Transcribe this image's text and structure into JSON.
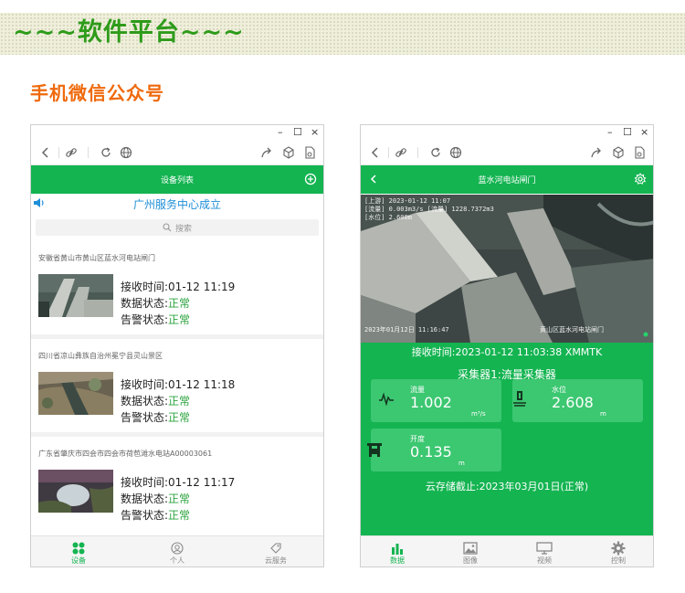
{
  "banner": {
    "title": "~~~软件平台~~~"
  },
  "section": {
    "title": "手机微信公众号"
  },
  "window": {
    "minimize": "–",
    "maximize": "☐",
    "close": "×"
  },
  "left_phone": {
    "header_title": "设备列表",
    "notice": "广州服务中心成立",
    "search_placeholder": "搜索",
    "devices": [
      {
        "title": "安徽省黄山市黄山区蓝水河电站闸门",
        "recv_label": "接收时间:",
        "recv_time": "01-12 11:19",
        "data_label": "数据状态:",
        "data_status": "正常",
        "alarm_label": "告警状态:",
        "alarm_status": "正常"
      },
      {
        "title": "四川省凉山彝族自治州冕宁县灵山景区",
        "recv_label": "接收时间:",
        "recv_time": "01-12 11:18",
        "data_label": "数据状态:",
        "data_status": "正常",
        "alarm_label": "告警状态:",
        "alarm_status": "正常"
      },
      {
        "title": "广东省肇庆市四会市四会市荷苞滩水电站A00003061",
        "recv_label": "接收时间:",
        "recv_time": "01-12 11:17",
        "data_label": "数据状态:",
        "data_status": "正常",
        "alarm_label": "告警状态:",
        "alarm_status": "正常"
      }
    ],
    "tabs": [
      {
        "label": "设备",
        "icon": "grid-icon"
      },
      {
        "label": "个人",
        "icon": "user-icon"
      },
      {
        "label": "云服务",
        "icon": "tag-icon"
      }
    ]
  },
  "right_phone": {
    "header_title": "蓝水河电站闸门",
    "video_overlay": {
      "line1": "[上游] 2023-01-12 11:07",
      "line2": "[流量] 0.003m3/s [流量] 1228.7372m3",
      "line3": "[水位] 2.600m",
      "timestamp": "2023年01月12日 11:16:47",
      "location": "黄山区蓝水河电站闸门"
    },
    "recv_line": "接收时间:2023-01-12 11:03:38 XMMTK",
    "collector_line": "采集器1:流量采集器",
    "cards": [
      {
        "label": "流量",
        "value": "1.002",
        "unit": "m³/s",
        "icon": "waveform-icon"
      },
      {
        "label": "水位",
        "value": "2.608",
        "unit": "m",
        "icon": "water-level-icon"
      },
      {
        "label": "开度",
        "value": "0.135",
        "unit": "m",
        "icon": "gate-icon"
      }
    ],
    "cloud_line": "云存储截止:2023年03月01日(正常)",
    "tabs": [
      {
        "label": "数据",
        "icon": "bar-chart-icon"
      },
      {
        "label": "图像",
        "icon": "image-icon"
      },
      {
        "label": "视频",
        "icon": "monitor-icon"
      },
      {
        "label": "控制",
        "icon": "gear-icon"
      }
    ]
  },
  "colors": {
    "accent_green": "#14b451",
    "title_green": "#2e9b1a",
    "section_orange": "#ef6a0d",
    "notice_blue": "#1e8fd8"
  }
}
